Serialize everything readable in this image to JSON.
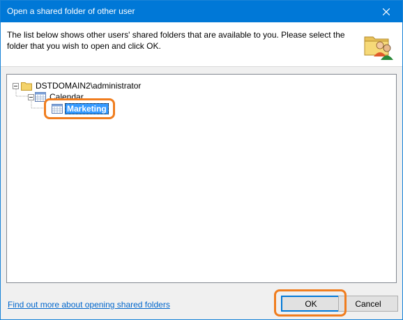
{
  "window": {
    "title": "Open a shared folder of other user"
  },
  "header": {
    "instruction": "The list below shows other users' shared folders that are available to you. Please select the folder that you wish to open and click OK."
  },
  "tree": {
    "root": {
      "label": "DSTDOMAIN2\\administrator",
      "expanded": true,
      "icon": "folder-icon"
    },
    "child": {
      "label": "Calendar",
      "expanded": true,
      "icon": "calendar-icon"
    },
    "grandchild": {
      "label": "Marketing",
      "selected": true,
      "icon": "calendar-icon"
    }
  },
  "footer": {
    "link_text": "Find out more about opening shared folders",
    "ok_label": "OK",
    "cancel_label": "Cancel"
  },
  "colors": {
    "titlebar": "#0078d7",
    "selection": "#3399ff",
    "highlight": "#f07d1e",
    "link": "#0066cc"
  }
}
